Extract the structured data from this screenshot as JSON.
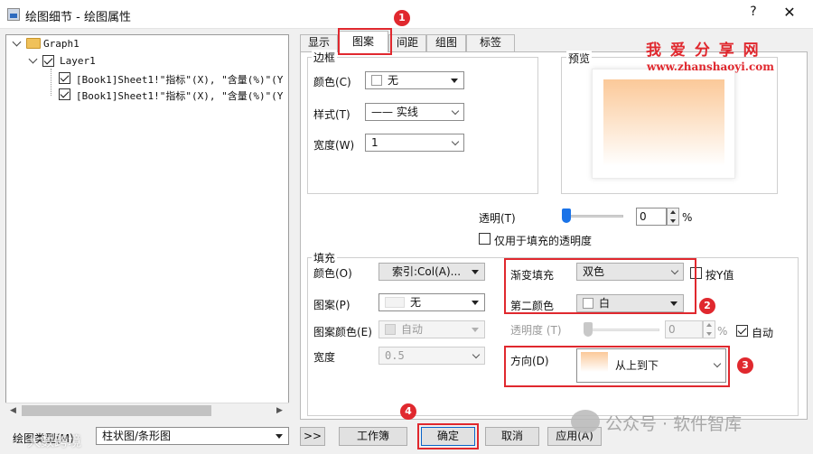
{
  "window": {
    "title": "绘图细节 - 绘图属性",
    "help": "?",
    "close": "✕"
  },
  "tree": {
    "root": "Graph1",
    "layer": "Layer1",
    "plots": [
      "[Book1]Sheet1!\"指标\"(X), \"含量(%)\"(Y",
      "[Book1]Sheet1!\"指标\"(X), \"含量(%)\"(Y"
    ]
  },
  "tabs": [
    "显示",
    "图案",
    "间距",
    "组图",
    "标签"
  ],
  "border": {
    "group": "边框",
    "color_label": "颜色(C)",
    "color_value": "无",
    "style_label": "样式(T)",
    "style_value": "—— 实线",
    "width_label": "宽度(W)",
    "width_value": "1"
  },
  "preview": {
    "label": "预览",
    "gradient_top": "#fbc999",
    "gradient_bottom": "#ffffff"
  },
  "transparency": {
    "label": "透明(T)",
    "value": "0",
    "unit": "%",
    "level": 0,
    "fill_only_label": "仅用于填充的透明度"
  },
  "fill": {
    "group": "填充",
    "color_label": "颜色(O)",
    "color_value": "索引:Col(A)...",
    "pattern_label": "图案(P)",
    "pattern_value": "无",
    "pattern_color_label": "图案颜色(E)",
    "pattern_color_value": "自动",
    "width_label": "宽度",
    "width_value": "0.5",
    "gradient_label": "渐变填充",
    "gradient_value": "双色",
    "by_y_label": "按Y值",
    "second_color_label": "第二颜色",
    "second_color_value": "白",
    "opacity_label": "透明度 (T)",
    "opacity_value": "0",
    "opacity_unit": "%",
    "auto_label": "自动",
    "direction_label": "方向(D)",
    "direction_value": "从上到下"
  },
  "bottom": {
    "plot_type_label": "绘图类型(M)",
    "plot_type_value": "柱状图/条形图",
    "expand": ">>",
    "workbook": "工作簿",
    "ok": "确定",
    "cancel": "取消",
    "apply": "应用(A)"
  },
  "badges": [
    "1",
    "2",
    "3",
    "4"
  ],
  "watermark": {
    "site": "我 爱 分 享 网",
    "url": "www.zhanshaoyi.com",
    "wechat": "公众号 · 软件智库",
    "corner": "大数跨境"
  },
  "colors": {
    "accent": "#e0282e",
    "slider": "#1a73e8",
    "fill_orange": "#fbc999"
  }
}
